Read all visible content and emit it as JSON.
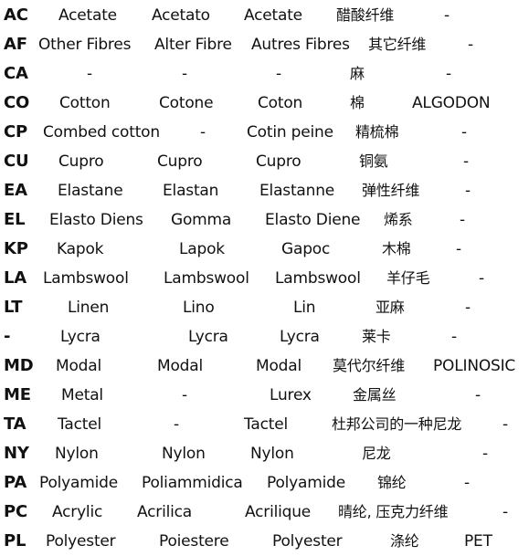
{
  "rows": [
    {
      "code": "AC",
      "english": "Acetate",
      "italian": "Acetato",
      "french": "Acetate",
      "chinese": "醋酸纤维",
      "spanish": "-"
    },
    {
      "code": "AF",
      "english": "Other Fibres",
      "italian": "Alter Fibre",
      "french": "Autres Fibres",
      "chinese": "其它纤维",
      "spanish": "-"
    },
    {
      "code": "CA",
      "english": "-",
      "italian": "-",
      "french": "-",
      "chinese": "麻",
      "spanish": "-"
    },
    {
      "code": "CO",
      "english": "Cotton",
      "italian": "Cotone",
      "french": "Coton",
      "chinese": "棉",
      "spanish": "ALGODON"
    },
    {
      "code": "CP",
      "english": "Combed cotton",
      "italian": "-",
      "french": "Cotin peine",
      "chinese": "精梳棉",
      "spanish": "-"
    },
    {
      "code": "CU",
      "english": "Cupro",
      "italian": "Cupro",
      "french": "Cupro",
      "chinese": "铜氨",
      "spanish": "-"
    },
    {
      "code": "EA",
      "english": "Elastane",
      "italian": "Elastan",
      "french": "Elastanne",
      "chinese": "弹性纤维",
      "spanish": "-"
    },
    {
      "code": "EL",
      "english": "Elasto Diens",
      "italian": "Gomma",
      "french": "Elasto Diene",
      "chinese": "烯系",
      "spanish": "-"
    },
    {
      "code": "KP",
      "english": "Kapok",
      "italian": "Lapok",
      "french": "Gapoc",
      "chinese": "木棉",
      "spanish": "-"
    },
    {
      "code": "LA",
      "english": "Lambswool",
      "italian": "Lambswool",
      "french": "Lambswool",
      "chinese": "羊仔毛",
      "spanish": "-"
    },
    {
      "code": "LT",
      "english": "Linen",
      "italian": "Lino",
      "french": "Lin",
      "chinese": "亚麻",
      "spanish": "-"
    },
    {
      "code": "-",
      "english": "Lycra",
      "italian": "Lycra",
      "french": "Lycra",
      "chinese": "莱卡",
      "spanish": "-"
    },
    {
      "code": "MD",
      "english": "Modal",
      "italian": "Modal",
      "french": "Modal",
      "chinese": "莫代尔纤维",
      "spanish": "POLINOSIC"
    },
    {
      "code": "ME",
      "english": "Metal",
      "italian": "-",
      "french": "Lurex",
      "chinese": "金属丝",
      "spanish": "-"
    },
    {
      "code": "TA",
      "english": "Tactel",
      "italian": "-",
      "french": "Tactel",
      "chinese": "杜邦公司的一种尼龙",
      "spanish": "-"
    },
    {
      "code": "NY",
      "english": "Nylon",
      "italian": "Nylon",
      "french": "Nylon",
      "chinese": "尼龙",
      "spanish": "-"
    },
    {
      "code": "PA",
      "english": "Polyamide",
      "italian": "Poliammidica",
      "french": "Polyamide",
      "chinese": "锦纶",
      "spanish": "-"
    },
    {
      "code": "PC",
      "english": "Acrylic",
      "italian": "Acrilica",
      "french": "Acrilique",
      "chinese": "晴纶, 压克力纤维",
      "spanish": "-"
    },
    {
      "code": "PL",
      "english": "Polyester",
      "italian": "Poiestere",
      "french": "Polyester",
      "chinese": "涤纶",
      "spanish": "PET"
    }
  ]
}
